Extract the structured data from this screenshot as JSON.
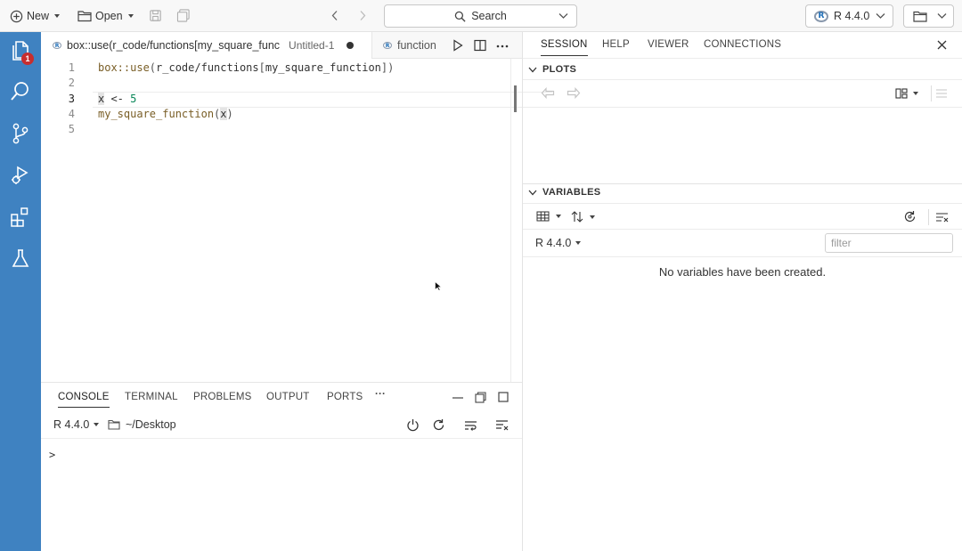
{
  "topbar": {
    "new_label": "New",
    "open_label": "Open",
    "search_label": "Search",
    "r_version": "R 4.4.0"
  },
  "activity_bar": {
    "explorer_badge": "1",
    "icons": [
      "files-icon",
      "search-icon",
      "source-control-icon",
      "run-debug-icon",
      "extensions-icon",
      "testing-icon"
    ]
  },
  "editor": {
    "tabs": [
      {
        "name": "box::use(r_code/functions[my_square_func",
        "description": "Untitled-1",
        "dirty": true
      },
      {
        "name": "function"
      }
    ],
    "lines": [
      {
        "number": "1"
      },
      {
        "number": "2"
      },
      {
        "number": "3"
      },
      {
        "number": "4"
      },
      {
        "number": "5"
      }
    ],
    "code": {
      "l1_call": "box::use",
      "l1_open": "(",
      "l1_path": "r_code/functions",
      "l1_bopen": "[",
      "l1_fn": "my_square_function",
      "l1_bclose": "]",
      "l1_close": ")",
      "l3_var": "x",
      "l3_op": " <- ",
      "l3_num": "5",
      "l4_fn": "my_square_function",
      "l4_open": "(",
      "l4_arg": "x",
      "l4_close": ")"
    }
  },
  "console": {
    "tabs": [
      "CONSOLE",
      "TERMINAL",
      "PROBLEMS",
      "OUTPUT",
      "PORTS"
    ],
    "more": "···",
    "r_version": "R 4.4.0",
    "working_dir": "~/Desktop",
    "prompt": ">"
  },
  "right_panel": {
    "tabs": [
      "SESSION",
      "HELP",
      "VIEWER",
      "CONNECTIONS"
    ],
    "plots_title": "PLOTS",
    "variables_title": "VARIABLES",
    "r_version": "R 4.4.0",
    "filter_placeholder": "filter",
    "empty_message": "No variables have been created."
  },
  "colors": {
    "activity_bar": "#3f82c1",
    "badge": "#c72e2e",
    "function_token": "#795e26",
    "number_token": "#098658"
  }
}
